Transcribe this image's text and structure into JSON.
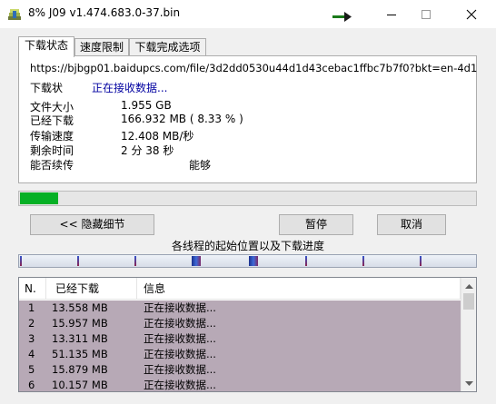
{
  "window": {
    "title": "8% J09 v1.474.683.0-37.bin",
    "min_icon": "minimize-icon",
    "max_icon": "maximize-icon",
    "close_icon": "close-icon"
  },
  "tabs": [
    {
      "label": "下载状态",
      "active": true
    },
    {
      "label": "速度限制",
      "active": false
    },
    {
      "label": "下载完成选项",
      "active": false
    }
  ],
  "status": {
    "url": "https://bjbgp01.baidupcs.com/file/3d2dd0530u44d1d43cebac1ffbc7b7f0?bkt=en-4d1",
    "status_label": "下载状",
    "status_value": "正在接收数据...",
    "file_size_label": "文件大小",
    "file_size_value": "1.955  GB",
    "downloaded_label": "已经下载",
    "downloaded_value": "166.932  MB ( 8.33 % )",
    "speed_label": "传输速度",
    "speed_value": "12.408  MB/秒",
    "remaining_label": "剩余时间",
    "remaining_value": "2 分 38 秒",
    "resume_label": "能否续传",
    "resume_value": "能够"
  },
  "progress": {
    "percent": 8.33,
    "color": "#06b025"
  },
  "buttons": {
    "hide_details": "<< 隐藏细节",
    "pause": "暂停",
    "cancel": "取消"
  },
  "threads": {
    "label": "各线程的起始位置以及下载进度",
    "count": 8
  },
  "list": {
    "headers": [
      "N.",
      "已经下载",
      "信息"
    ],
    "rows": [
      {
        "n": "1",
        "downloaded": "13.558  MB",
        "info": "正在接收数据..."
      },
      {
        "n": "2",
        "downloaded": "15.957  MB",
        "info": "正在接收数据..."
      },
      {
        "n": "3",
        "downloaded": "13.311  MB",
        "info": "正在接收数据..."
      },
      {
        "n": "4",
        "downloaded": "51.135  MB",
        "info": "正在接收数据..."
      },
      {
        "n": "5",
        "downloaded": "15.879  MB",
        "info": "正在接收数据..."
      },
      {
        "n": "6",
        "downloaded": "10.157  MB",
        "info": "正在接收数据..."
      }
    ],
    "row_color": "#b7a9b6"
  }
}
